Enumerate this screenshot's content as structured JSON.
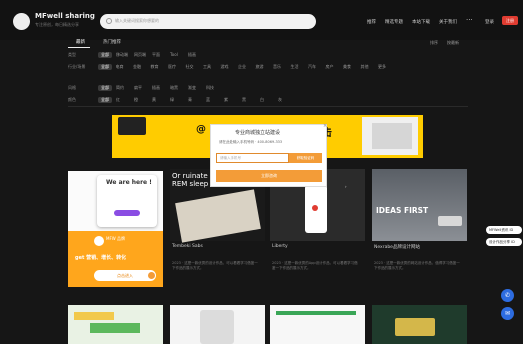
{
  "header": {
    "site_title": "MFwell sharing",
    "site_subtitle": "专注原创，每日精选分享",
    "search_placeholder": "输入关键词搜索你想要的",
    "nav": [
      "推荐",
      "精选专题",
      "本站下载",
      "关于我们"
    ],
    "more": "···",
    "login": "登录",
    "register": "注册"
  },
  "tabs": {
    "items": [
      "最新",
      "热门推荐"
    ],
    "sort_label": "排序",
    "sort_value": "按最新"
  },
  "filters": [
    {
      "label": "类型",
      "items": [
        "全部",
        "移动端",
        "网页端",
        "平面",
        "Tool",
        "插画"
      ]
    },
    {
      "label": "行业/场景",
      "items": [
        "全部",
        "电商",
        "金融",
        "教育",
        "医疗",
        "社交",
        "工具",
        "游戏",
        "企业",
        "旅游",
        "音乐",
        "生活",
        "汽车",
        "房产",
        "美食",
        "其他",
        "更多"
      ]
    },
    {
      "label": "风格",
      "items": [
        "全部",
        "简约",
        "扁平",
        "插画",
        "暗黑",
        "渐变",
        "科技"
      ]
    },
    {
      "label": "颜色",
      "items": [
        "全部",
        "红",
        "橙",
        "黄",
        "绿",
        "青",
        "蓝",
        "紫",
        "黑",
        "白",
        "灰"
      ]
    }
  ],
  "banner": {
    "text_start": "@",
    "text_end": "击"
  },
  "popup": {
    "title": "专业商城独立站建设",
    "subtitle": "请在此处输入手机号码 · 400-8069-333",
    "input_placeholder": "请输入手机号",
    "get_code": "获取验证码",
    "submit": "立即咨询",
    "close": "×"
  },
  "cards": [
    {
      "kind": "poster",
      "phone_title": "We are here !",
      "badge_text": "MFW 品牌",
      "headline": "get 营销、增长、转化",
      "button": "点击进入"
    },
    {
      "title": "Tembeki Sabs",
      "thumb_text": "Or ruinate deeper, lo REM sleep",
      "desc": "2023 · 这是一款优秀的设计作品，可以看看学习借鉴一下作品的展示方式。"
    },
    {
      "title": "Liberty",
      "thumb_text": "",
      "desc": "2023 · 这是一款优秀的App设计作品，可以看看学习借鉴一下作品的展示方式。"
    },
    {
      "title": "Nexrabe品牌设计网站",
      "thumb_text": "IDEAS FIRST",
      "desc": "2023 · 这是一款优秀的网站设计作品，值得学习借鉴一下作品的展示方式。"
    }
  ],
  "side": {
    "pill1": "MFWell资讯 ID",
    "pill2": "设计作品分享 ID"
  },
  "colors": {
    "accent_orange": "#f39c38",
    "banner_yellow": "#ffcc00",
    "register_red": "#e03c31",
    "side_blue": "#2d6ce0"
  }
}
